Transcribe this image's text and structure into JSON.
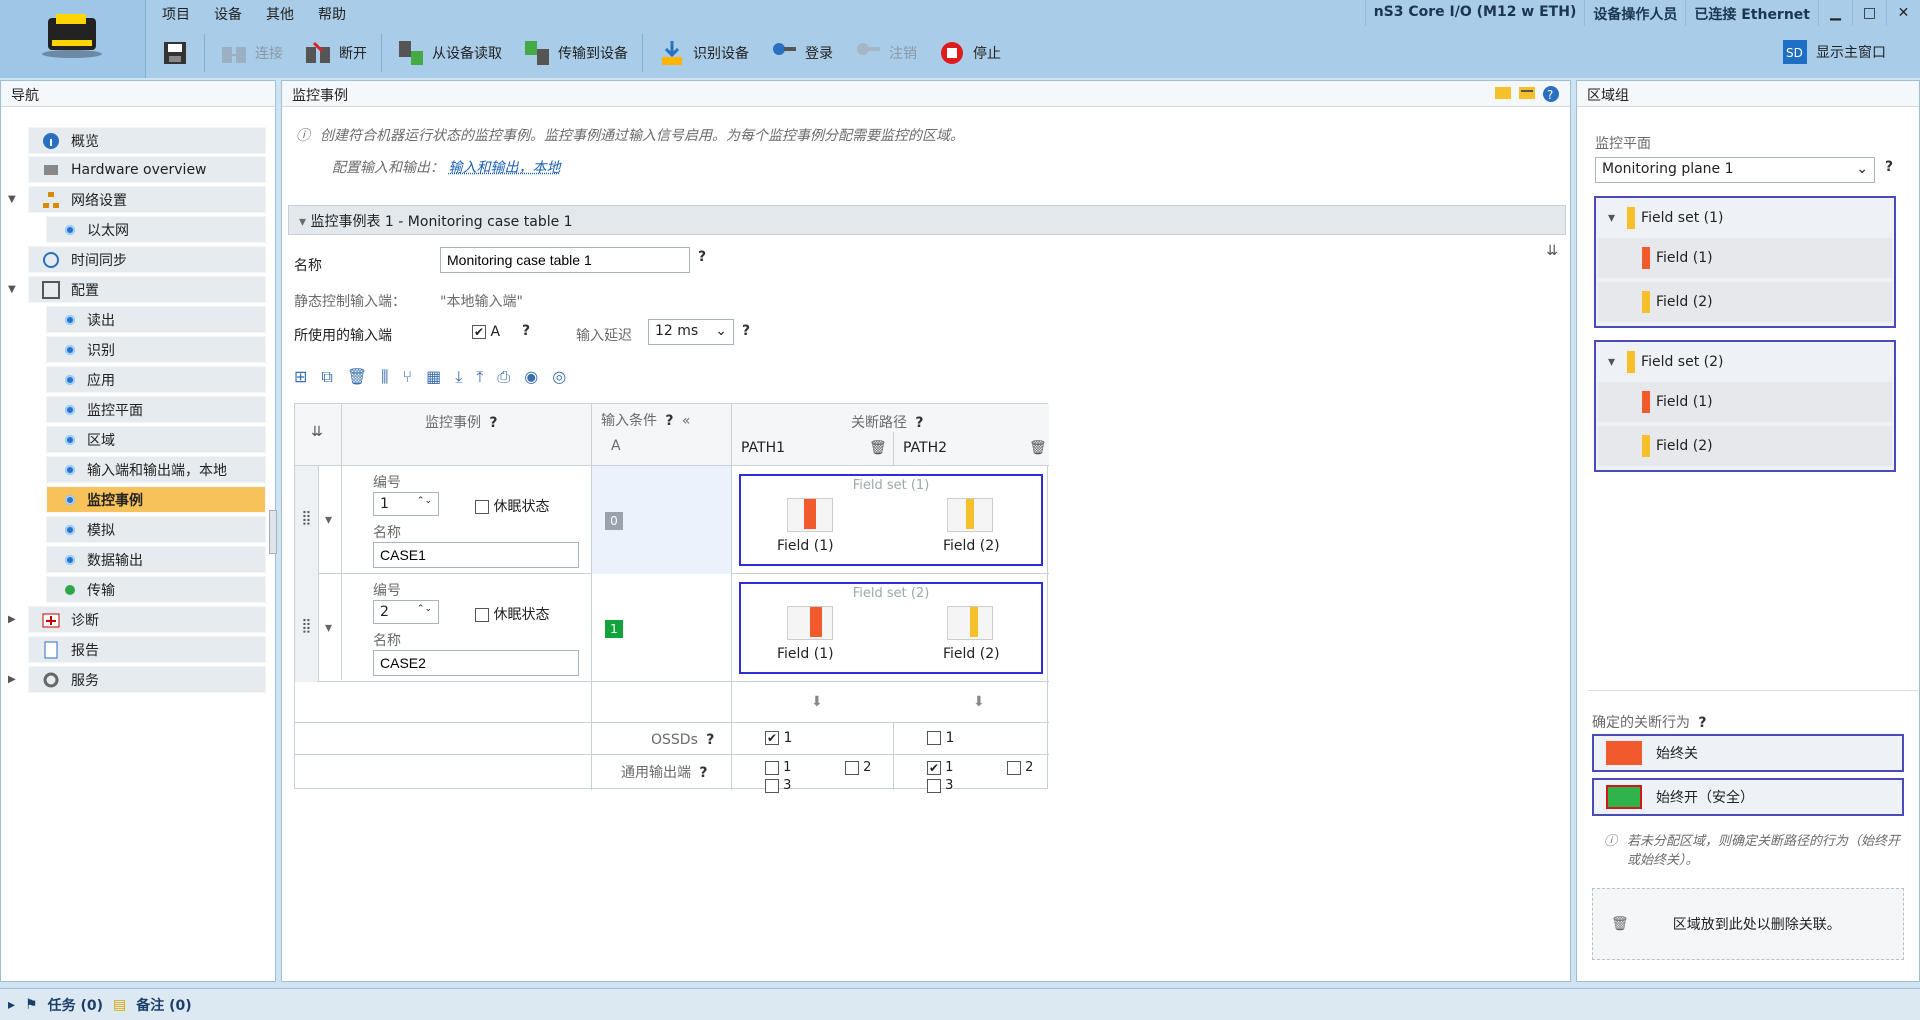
{
  "app": {
    "menu": [
      "项目",
      "设备",
      "其他",
      "帮助"
    ],
    "product": "nS3 Core I/O (M12 w ETH)",
    "user": "设备操作人员",
    "connection": "已连接 Ethernet",
    "min": "▁",
    "max": "□",
    "close": "✕"
  },
  "toolbar": {
    "connect": "连接",
    "disconnect": "断开",
    "read": "从设备读取",
    "transfer": "传输到设备",
    "identify": "识别设备",
    "login": "登录",
    "logout": "注销",
    "stop": "停止",
    "show_main": "显示主窗口"
  },
  "nav": {
    "title": "导航",
    "items": [
      {
        "label": "概览"
      },
      {
        "label": "Hardware overview"
      },
      {
        "label": "网络设置"
      },
      {
        "label": "以太网"
      },
      {
        "label": "时间同步"
      },
      {
        "label": "配置"
      },
      {
        "label": "读出"
      },
      {
        "label": "识别"
      },
      {
        "label": "应用"
      },
      {
        "label": "监控平面"
      },
      {
        "label": "区域"
      },
      {
        "label": "输入端和输出端，本地"
      },
      {
        "label": "监控事例"
      },
      {
        "label": "模拟"
      },
      {
        "label": "数据输出"
      },
      {
        "label": "传输"
      },
      {
        "label": "诊断"
      },
      {
        "label": "报告"
      },
      {
        "label": "服务"
      }
    ]
  },
  "main": {
    "title": "监控事例",
    "info": "创建符合机器运行状态的监控事例。监控事例通过输入信号启用。为每个监控事例分配需要监控的区域。",
    "config_label": "配置输入和输出：",
    "config_link": "输入和输出，本地",
    "section": "监控事例表 1 - Monitoring case table 1",
    "name_label": "名称",
    "name_value": "Monitoring case table 1",
    "static_label": "静态控制输入端：",
    "static_value": "\"本地输入端\"",
    "used_label": "所使用的输入端",
    "used_value": "A",
    "delay_label": "输入延迟",
    "delay_value": "12 ms",
    "table": {
      "col_case": "监控事例",
      "col_cond": "输入条件",
      "col_cond_a": "A",
      "col_paths": "关断路径",
      "path1": "PATH1",
      "path2": "PATH2",
      "num_label": "编号",
      "name_label": "名称",
      "sleep_label": "休眠状态",
      "cases": [
        {
          "num": "1",
          "name": "CASE1",
          "cond": "0",
          "fieldset": "Field set (1)",
          "f1": "Field (1)",
          "f2": "Field (2)"
        },
        {
          "num": "2",
          "name": "CASE2",
          "cond": "1",
          "fieldset": "Field set (2)",
          "f1": "Field (1)",
          "f2": "Field (2)"
        }
      ],
      "ossd_label": "OSSDs",
      "gen_label": "通用输出端",
      "o1": "1",
      "o2": "2",
      "o3": "3"
    }
  },
  "right": {
    "title": "区域组",
    "plane_label": "监控平面",
    "plane_value": "Monitoring plane 1",
    "sets": [
      {
        "name": "Field set (1)",
        "fields": [
          "Field (1)",
          "Field (2)"
        ]
      },
      {
        "name": "Field set (2)",
        "fields": [
          "Field (1)",
          "Field (2)"
        ]
      }
    ],
    "behavior_label": "确定的关断行为",
    "always_off": "始终关",
    "always_on": "始终开（安全）",
    "note": "若未分配区域，则确定关断路径的行为（始终开或始终关）。",
    "drop": "区域放到此处以删除关联。"
  },
  "statusbar": {
    "tasks": "任务 (0)",
    "notes": "备注 (0)"
  },
  "colors": {
    "accent": "#f8c25a",
    "red": "#f05a2c",
    "green": "#2fb34a",
    "yellow": "#f6c02a",
    "link": "#1a5fb4"
  }
}
